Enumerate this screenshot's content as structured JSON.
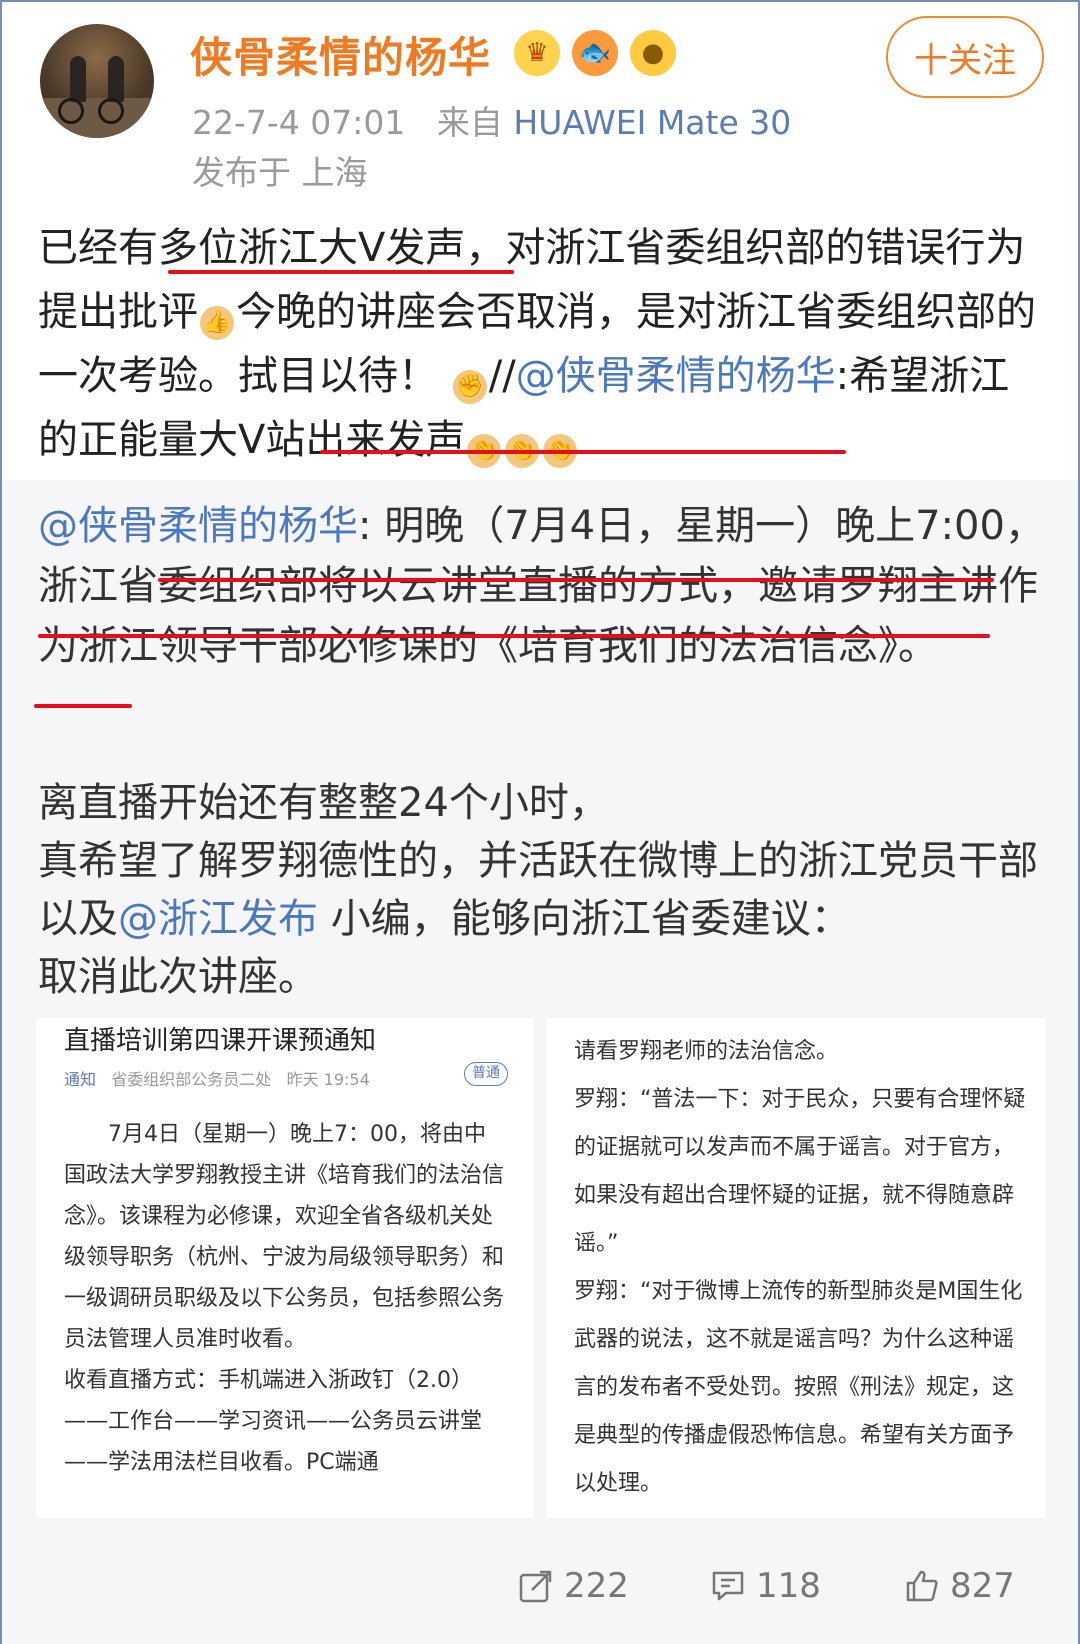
{
  "header": {
    "username": "侠骨柔情的杨华",
    "badges": [
      "crown-badge",
      "koi-badge",
      "puffer-badge"
    ],
    "follow_label": "十关注",
    "time": "22-7-4 07:01",
    "source_prefix": "来自",
    "device": "HUAWEI Mate 30",
    "location": "发布于 上海"
  },
  "post": {
    "p1": "已经有多位浙江大V发声，对浙江省委组织部的错误行为提出批评",
    "p2": "今晚的讲座会否取消，是对浙江省委组织部的一次考验。拭目以待！",
    "p3": "//",
    "mention": "@侠骨柔情的杨华",
    "p4": ":希望浙江的正能量大V站出来发声"
  },
  "repost": {
    "mention": "@侠骨柔情的杨华",
    "text": ": 明晚（7月4日，星期一）晚上7:00，浙江省委组织部将以云讲堂直播的方式，邀请罗翔主讲作为浙江领导干部必修课的《培育我们的法治信念》。"
  },
  "extra": {
    "line1": "离直播开始还有整整24个小时，",
    "line2": "真希望了解罗翔德性的，并活跃在微博上的浙江党员干部以及",
    "mention": "@浙江发布",
    "line3": " 小编，能够向浙江省委建议：",
    "line4": "取消此次讲座。"
  },
  "image1": {
    "title": "直播培训第四课开课预通知",
    "tag": "通知",
    "source": "省委组织部公务员二处",
    "time": "昨天 19:54",
    "pill": "普通",
    "body": "7月4日（星期一）晚上7：00，将由中国政法大学罗翔教授主讲《培育我们的法治信念》。该课程为必修课，欢迎全省各级机关处级领导职务（杭州、宁波为局级领导职务）和一级调研员职级及以下公务员，包括参照公务员法管理人员准时收看。",
    "body2": "收看直播方式：手机端进入浙政钉（2.0）——工作台——学习资讯——公务员云讲堂——学法用法栏目收看。PC端通"
  },
  "image2": {
    "l1": "请看罗翔老师的法治信念。",
    "l2": "罗翔：“普法一下：对于民众，只要有合理怀疑的证据就可以发声而不属于谣言。对于官方，如果没有超出合理怀疑的证据，就不得随意辟谣。”",
    "l3": "罗翔：“对于微博上流传的新型肺炎是M国生化武器的说法，这不就是谣言吗？为什么这种谣言的发布者不受处罚。按照《刑法》规定，这是典型的传播虚假恐怖信息。希望有关方面予以处理。"
  },
  "footer": {
    "shares": "222",
    "comments": "118",
    "likes": "827"
  },
  "colors": {
    "username": "#f07a22",
    "link": "#4a78c2",
    "underline": "#e3101b"
  }
}
